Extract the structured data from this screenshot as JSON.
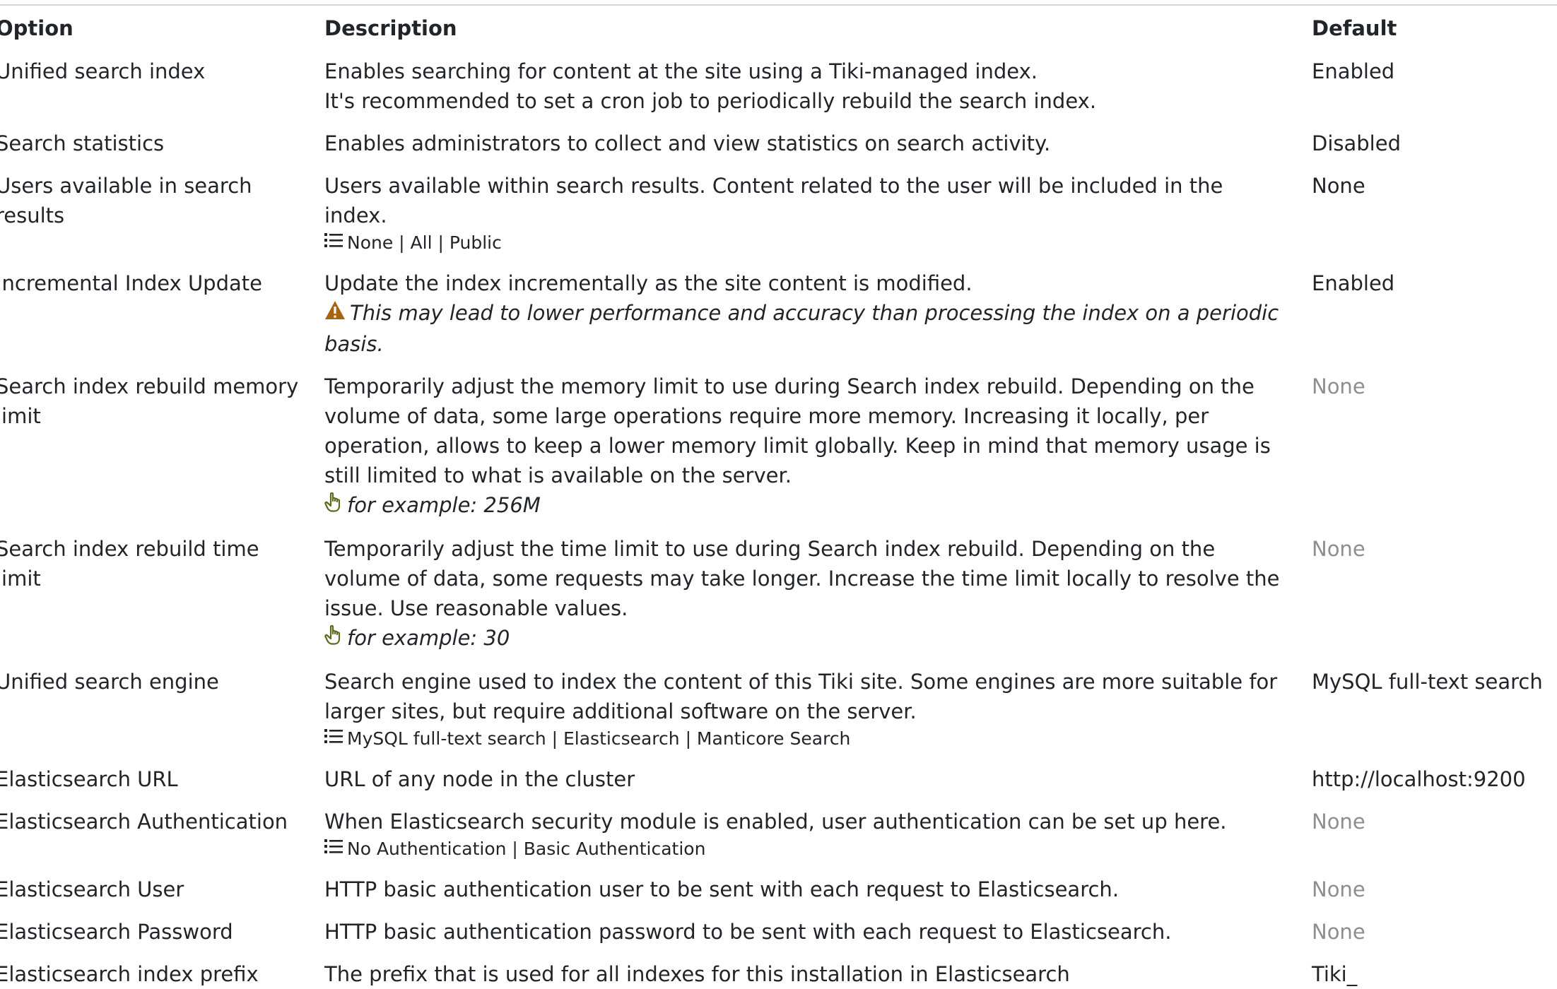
{
  "headers": {
    "option": "Option",
    "description": "Description",
    "default": "Default"
  },
  "rows": [
    {
      "option": "Unified search index",
      "description": [
        "Enables searching for content at the site using a Tiki-managed index.",
        "It's recommended to set a cron job to periodically rebuild the search index."
      ],
      "default": "Enabled"
    },
    {
      "option": "Search statistics",
      "description": [
        "Enables administrators to collect and view statistics on search activity."
      ],
      "default": "Disabled"
    },
    {
      "option": "Users available in search results",
      "description": [
        "Users available within search results. Content related to the user will be included in the index."
      ],
      "options": "None | All | Public",
      "default": "None"
    },
    {
      "option": "Incremental Index Update",
      "description": [
        "Update the index incrementally as the site content is modified."
      ],
      "warning": "This may lead to lower performance and accuracy than processing the index on a periodic basis.",
      "default": "Enabled"
    },
    {
      "option": "Search index rebuild memory limit",
      "description": [
        "Temporarily adjust the memory limit to use during Search index rebuild. Depending on the volume of data, some large operations require more memory. Increasing it locally, per operation, allows to keep a lower memory limit globally. Keep in mind that memory usage is still limited to what is available on the server."
      ],
      "example": "for example: 256M",
      "default": "None"
    },
    {
      "option": "Search index rebuild time limit",
      "description": [
        "Temporarily adjust the time limit to use during Search index rebuild. Depending on the volume of data, some requests may take longer. Increase the time limit locally to resolve the issue. Use reasonable values."
      ],
      "example": "for example: 30",
      "default": "None"
    },
    {
      "option": "Unified search engine",
      "description": [
        "Search engine used to index the content of this Tiki site. Some engines are more suitable for larger sites, but require additional software on the server."
      ],
      "options": "MySQL full-text search | Elasticsearch | Manticore Search",
      "default": "MySQL full-text search"
    },
    {
      "option": "Elasticsearch URL",
      "description": [
        "URL of any node in the cluster"
      ],
      "default": "http://localhost:9200"
    },
    {
      "option": "Elasticsearch Authentication",
      "description": [
        "When Elasticsearch security module is enabled, user authentication can be set up here."
      ],
      "options": "No Authentication | Basic Authentication",
      "default": "None"
    },
    {
      "option": "Elasticsearch User",
      "description": [
        "HTTP basic authentication user to be sent with each request to Elasticsearch."
      ],
      "default": "None"
    },
    {
      "option": "Elasticsearch Password",
      "description": [
        "HTTP basic authentication password to be sent with each request to Elasticsearch."
      ],
      "default": "None"
    },
    {
      "option": "Elasticsearch index prefix",
      "description": [
        "The prefix that is used for all indexes for this installation in Elasticsearch"
      ],
      "default": "Tiki_"
    }
  ],
  "icons": {
    "options": "list-icon",
    "warning": "warning-triangle-icon",
    "example": "pointing-hand-icon"
  },
  "colors": {
    "text": "#212529",
    "muted_default": "#8e8e8e",
    "warning_icon": "#a8650f",
    "hint_icon": "#5a6b1f"
  }
}
